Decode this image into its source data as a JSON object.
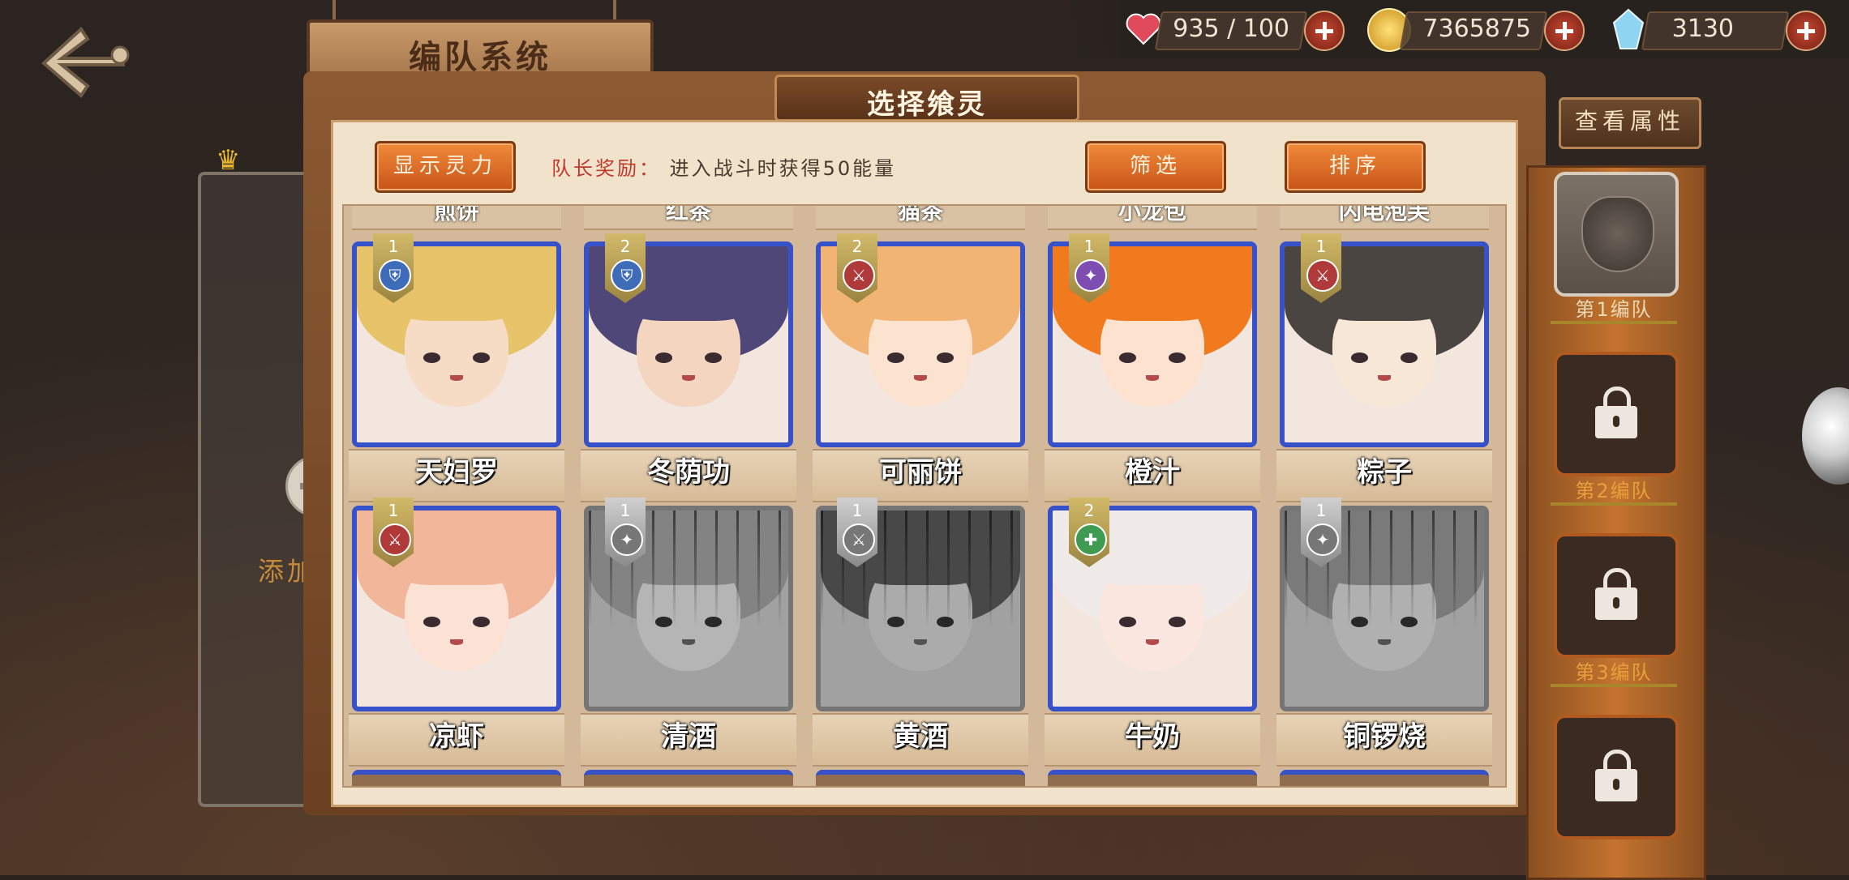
{
  "header": {
    "page_title": "编队系统"
  },
  "resources": [
    {
      "name": "stamina",
      "icon": "heart-icon",
      "value": "935 / 100"
    },
    {
      "name": "gold",
      "icon": "coin-icon",
      "value": "7365875"
    },
    {
      "name": "crystal",
      "icon": "crystal-icon",
      "value": "3130"
    }
  ],
  "team_card": {
    "add_label": "添加"
  },
  "panel": {
    "title": "选择飨灵",
    "show_power_btn": "显示灵力",
    "captain_reward_label": "队长奖励：",
    "captain_reward_text": "进入战斗时获得50能量",
    "filter_btn": "筛选",
    "sort_btn": "排序",
    "top_partial_names": [
      "煎饼",
      "红茶",
      "猫茶",
      "小龙包",
      "闪电泡芙"
    ]
  },
  "characters": [
    {
      "name": "天妇罗",
      "rank": "1",
      "role": "shield",
      "owned": true,
      "hair": "#e7c46a",
      "skin": "#f6dcc4"
    },
    {
      "name": "冬荫功",
      "rank": "2",
      "role": "shield",
      "owned": true,
      "hair": "#4f4778",
      "skin": "#f4d5c0"
    },
    {
      "name": "可丽饼",
      "rank": "2",
      "role": "sword",
      "owned": true,
      "hair": "#f1b474",
      "skin": "#fbe3cf"
    },
    {
      "name": "橙汁",
      "rank": "1",
      "role": "star",
      "owned": true,
      "hair": "#f27a1e",
      "skin": "#fde2cf"
    },
    {
      "name": "粽子",
      "rank": "1",
      "role": "sword",
      "owned": true,
      "hair": "#4a4540",
      "skin": "#f6e7d6"
    },
    {
      "name": "凉虾",
      "rank": "1",
      "role": "sword",
      "owned": true,
      "hair": "#f2b79a",
      "skin": "#fbe2d4"
    },
    {
      "name": "清酒",
      "rank": "1",
      "role": "star",
      "owned": false,
      "hair": "#9a9a9a",
      "skin": "#d5d5d5"
    },
    {
      "name": "黄酒",
      "rank": "1",
      "role": "sword",
      "owned": false,
      "hair": "#555555",
      "skin": "#c9c9c9"
    },
    {
      "name": "牛奶",
      "rank": "2",
      "role": "heal",
      "owned": true,
      "hair": "#f0ebe8",
      "skin": "#fbe6e0"
    },
    {
      "name": "铜锣烧",
      "rank": "1",
      "role": "star",
      "owned": false,
      "hair": "#8f8f98",
      "skin": "#cfcfd6"
    }
  ],
  "sidebar": {
    "view_attributes_btn": "查看属性",
    "teams": [
      {
        "label": "第1编队",
        "locked": false
      },
      {
        "label": "第2编队",
        "locked": true
      },
      {
        "label": "第3编队",
        "locked": true
      },
      {
        "label": "",
        "locked": true
      }
    ]
  },
  "colors": {
    "owned_border": "#3752c8",
    "locked_border": "#8a8a8a",
    "accent_orange": "#e07030"
  }
}
